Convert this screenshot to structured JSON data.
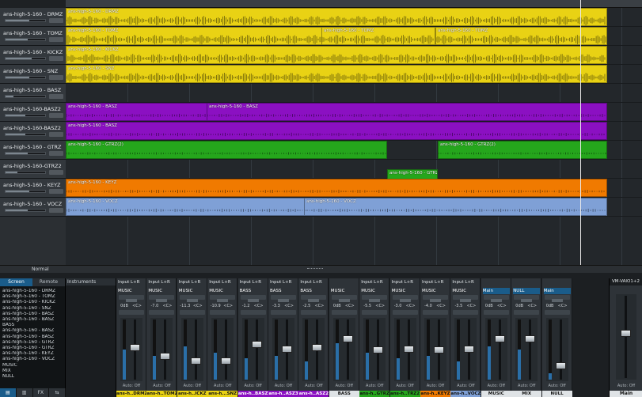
{
  "colors": {
    "yellow": "#e9d214",
    "purple": "#8b10c2",
    "green": "#25a61c",
    "orange": "#f07a00",
    "blue": "#7fa0d6",
    "accent": "#1a5c8a"
  },
  "tracks": [
    {
      "name": "ans-high-5-160 - DRMZ",
      "color": "yellow",
      "clips": [
        {
          "label": "ans-high-5-160 - DRMZ"
        }
      ]
    },
    {
      "name": "ans-high-5-160 - TOMZ",
      "color": "yellow",
      "clips": [
        {
          "label": "ans-high-5-160 - TOMZ"
        },
        {
          "label": "ans-high-5-160 - TOMZ"
        },
        {
          "label": "ans-high-5-160 - TOMZ"
        },
        {
          "label": "ans-high-5-160 - TOMZ"
        }
      ]
    },
    {
      "name": "ans-high-5-160 - KICKZ",
      "color": "yellow",
      "clips": [
        {
          "label": "ans-high-5-160 - KICKZ"
        }
      ]
    },
    {
      "name": "ans-high-5-160 - SNZ",
      "color": "yellow",
      "clips": [
        {
          "label": "ans-high-5-160 - SNZ"
        }
      ]
    },
    {
      "name": "ans-high-5-160 - BASZ",
      "color": "none",
      "clips": []
    },
    {
      "name": "ans-high-5-160-BASZ2",
      "color": "purple",
      "clips": [
        {
          "label": "ans-high-5-160 - BASZ"
        },
        {
          "label": "ans-high-5-160 - BASZ"
        }
      ]
    },
    {
      "name": "ans-high-5-160-BASZ2",
      "color": "purple",
      "clips": [
        {
          "label": "ans-high-5-160 - BASZ"
        }
      ]
    },
    {
      "name": "ans-high-5-160 - GTRZ",
      "color": "green",
      "clips": [
        {
          "label": "ans-high-5-160 - GTRZ(2)"
        },
        {
          "label": "ans-high-5-160 - GTRZ(2)"
        }
      ]
    },
    {
      "name": "ans-high-5-160-GTRZ2",
      "color": "green",
      "clips": [
        {
          "label": "ans-high-5-160 - GTRZ(2)"
        }
      ]
    },
    {
      "name": "ans-high-5-160 - KEYZ",
      "color": "orange",
      "clips": [
        {
          "label": "ans-high-5-160 - KEYZ"
        }
      ]
    },
    {
      "name": "ans-high-5-160 - VOCZ",
      "color": "blue",
      "clips": [
        {
          "label": "ans-high-5-160 - VOCZ"
        },
        {
          "label": "ans-high-5-160 - VOCZ"
        }
      ]
    }
  ],
  "arrange_status": {
    "mode": "Normal"
  },
  "browser": {
    "tabs": [
      "Screen",
      "Remote"
    ],
    "items": [
      "ans-high-5-160 - DRMZ",
      "ans-high-5-160 - TOMZ",
      "ans-high-5-160 - KICKZ",
      "ans-high-5-160 - SNZ",
      "ans-high-5-160 - BASZ",
      "ans-high-5-160 - BASZ",
      "BASS",
      "ans-high-5-160 - BASZ",
      "ans-high-5-160 - BASZ",
      "ans-high-5-160 - GTRZ",
      "ans-high-5-160 - GTRZ",
      "ans-high-5-160 - KEYZ",
      "ans-high-5-160 - VOCZ",
      "MUSIC",
      "MIX",
      "NULL"
    ],
    "buttons": [
      "▤",
      "▥",
      "FX",
      "⇆"
    ]
  },
  "instruments": {
    "header": "Instruments"
  },
  "strips": [
    {
      "input": "Input L+R",
      "output": "MUSIC",
      "vals": [
        "0dB",
        "<C>"
      ],
      "fader": 0.55,
      "meter": 0.5,
      "name": "ans-h..DRMZ",
      "name_bg": "#e9d214",
      "name_fg": "#111"
    },
    {
      "input": "Input L+R",
      "output": "MUSIC",
      "vals": [
        "-7.0",
        "<C>"
      ],
      "fader": 0.38,
      "meter": 0.4,
      "name": "ans-h..TOMZ",
      "name_bg": "#e9d214",
      "name_fg": "#111"
    },
    {
      "input": "Input L+R",
      "output": "MUSIC",
      "vals": [
        "-11.3",
        "<C>"
      ],
      "fader": 0.3,
      "meter": 0.55,
      "name": "ans-h..ICKZ",
      "name_bg": "#e9d214",
      "name_fg": "#111"
    },
    {
      "input": "Input L+R",
      "output": "MUSIC",
      "vals": [
        "-10.9",
        "<C>"
      ],
      "fader": 0.3,
      "meter": 0.45,
      "name": "ans-h...SNZ",
      "name_bg": "#e9d214",
      "name_fg": "#111"
    },
    {
      "input": "Input L+R",
      "output": "BASS",
      "vals": [
        "-1.2",
        "<C>"
      ],
      "fader": 0.6,
      "meter": 0.35,
      "name": "ans-h..BASZ",
      "name_bg": "#8b10c2",
      "name_fg": "#fff"
    },
    {
      "input": "Input L+R",
      "output": "BASS",
      "vals": [
        "-3.3",
        "<C>"
      ],
      "fader": 0.52,
      "meter": 0.4,
      "name": "ans-h..ASZ3",
      "name_bg": "#8b10c2",
      "name_fg": "#fff"
    },
    {
      "input": "Input L+R",
      "output": "BASS",
      "vals": [
        "-2.5",
        "<C>"
      ],
      "fader": 0.55,
      "meter": 0.3,
      "name": "ans-h..ASZ2",
      "name_bg": "#8b10c2",
      "name_fg": "#fff"
    },
    {
      "input": "",
      "output": "MUSIC",
      "vals": [
        "0dB",
        "<C>"
      ],
      "fader": 0.7,
      "meter": 0.6,
      "name": "BASS",
      "name_bg": "#dfe3e6",
      "name_fg": "#111"
    },
    {
      "input": "Input L+R",
      "output": "MUSIC",
      "vals": [
        "-5.5",
        "<C>"
      ],
      "fader": 0.5,
      "meter": 0.45,
      "name": "ans-h..GTRZ",
      "name_bg": "#25a61c",
      "name_fg": "#111"
    },
    {
      "input": "Input L+R",
      "output": "MUSIC",
      "vals": [
        "-3.0",
        "<C>"
      ],
      "fader": 0.52,
      "meter": 0.35,
      "name": "ans-h..TRZ2",
      "name_bg": "#25a61c",
      "name_fg": "#111"
    },
    {
      "input": "Input L+R",
      "output": "MUSIC",
      "vals": [
        "-4.0",
        "<C>"
      ],
      "fader": 0.5,
      "meter": 0.4,
      "name": "ans-h..KEYZ",
      "name_bg": "#f07a00",
      "name_fg": "#111"
    },
    {
      "input": "Input L+R",
      "output": "MUSIC",
      "vals": [
        "-3.5",
        "<C>"
      ],
      "fader": 0.52,
      "meter": 0.3,
      "name": "ans-h..VOCZ",
      "name_bg": "#7fa0d6",
      "name_fg": "#111"
    },
    {
      "input": "",
      "output": "Main",
      "vals": [
        "0dB",
        "<C>"
      ],
      "fader": 0.7,
      "meter": 0.55,
      "name": "MUSIC",
      "name_bg": "#dfe3e6",
      "name_fg": "#111"
    },
    {
      "input": "",
      "output": "NULL",
      "vals": [
        "0dB",
        "<C>"
      ],
      "fader": 0.7,
      "meter": 0.5,
      "name": "MIX",
      "name_bg": "#dfe3e6",
      "name_fg": "#111"
    },
    {
      "input": "",
      "output": "Main",
      "vals": [
        "0dB",
        "<C>"
      ],
      "fader": 0.2,
      "meter": 0.1,
      "name": "NULL",
      "name_bg": "#dfe3e6",
      "name_fg": "#111"
    }
  ],
  "master": {
    "device": "VM-VAIO1+2",
    "auto": "Auto: Off",
    "name": "Main",
    "fader": 0.55
  },
  "auto_label": "Auto: Off"
}
